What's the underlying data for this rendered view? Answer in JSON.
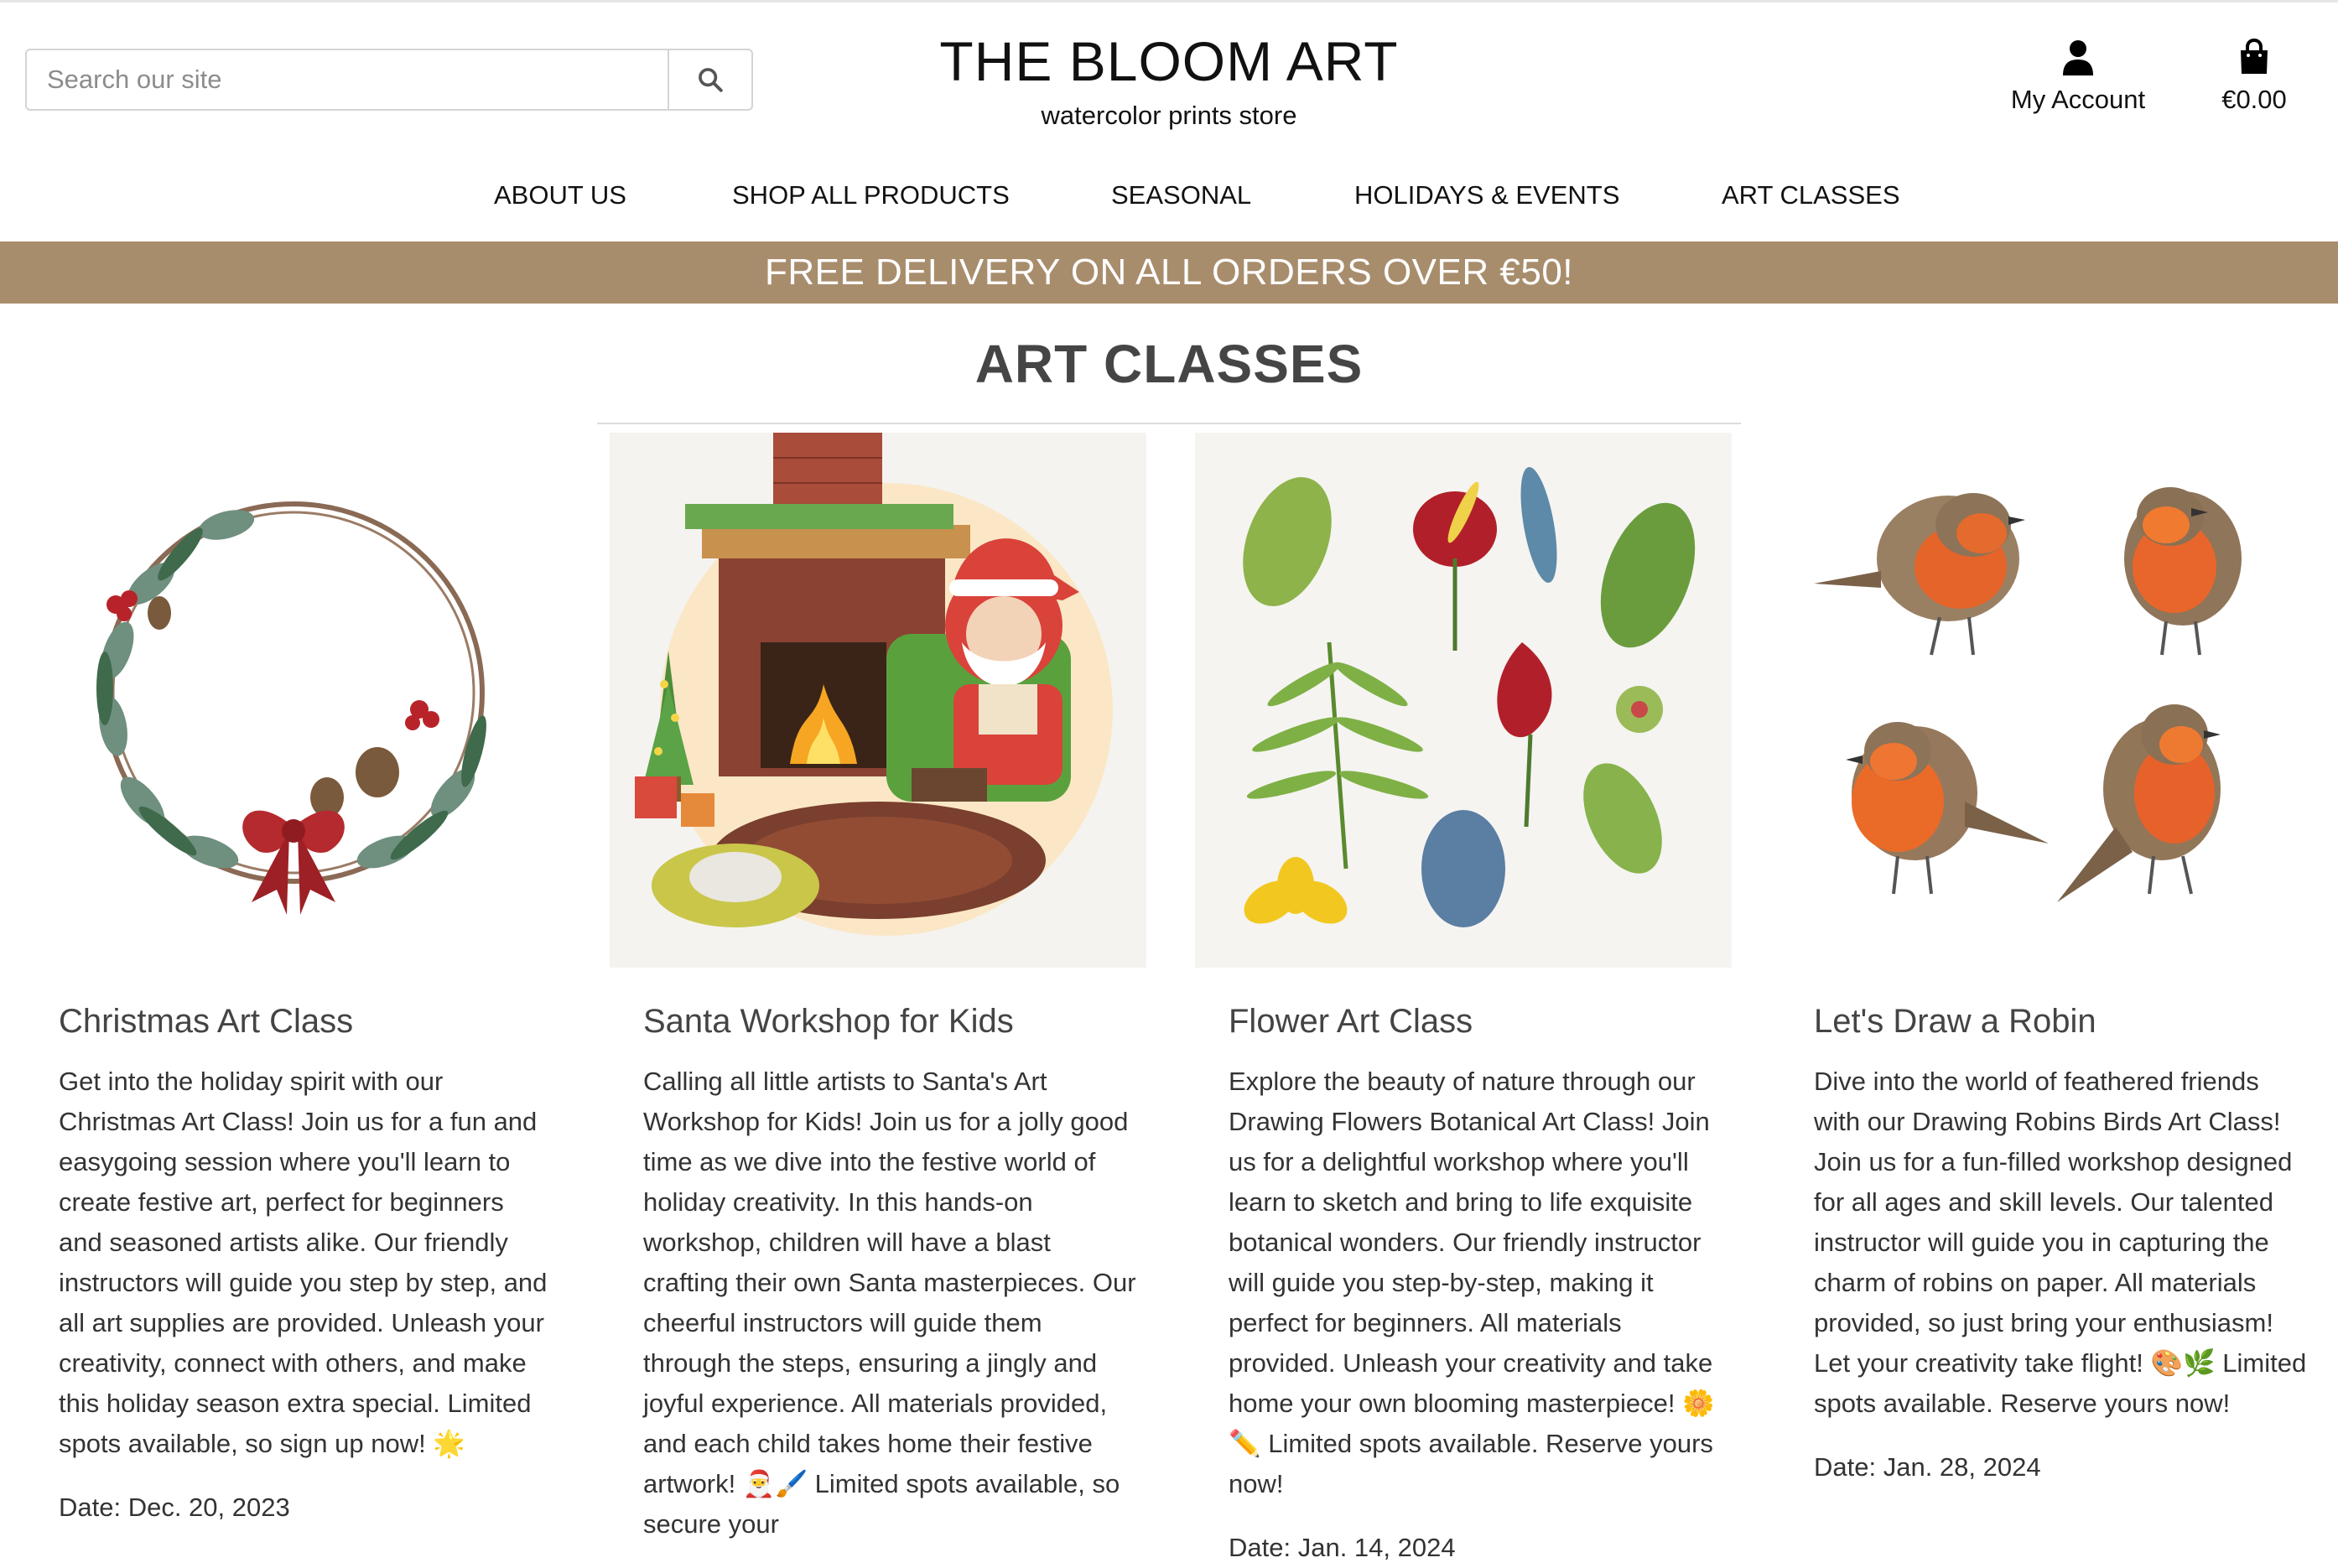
{
  "search": {
    "placeholder": "Search our site",
    "icon": "search-icon"
  },
  "brand": {
    "title": "THE BLOOM ART",
    "subtitle": "watercolor prints store"
  },
  "account": {
    "label": "My Account",
    "icon": "user-icon"
  },
  "cart": {
    "total": "€0.00",
    "icon": "shopping-bag-icon"
  },
  "nav": {
    "items": [
      {
        "label": "ABOUT US"
      },
      {
        "label": "SHOP ALL PRODUCTS"
      },
      {
        "label": "SEASONAL"
      },
      {
        "label": "HOLIDAYS & EVENTS"
      },
      {
        "label": "ART CLASSES"
      }
    ]
  },
  "banner": {
    "text": "FREE DELIVERY ON ALL ORDERS OVER €50!"
  },
  "page": {
    "title": "ART CLASSES"
  },
  "classes": [
    {
      "title": "Christmas Art Class",
      "description": "Get into the holiday spirit with our Christmas Art Class! Join us for a fun and easygoing session where you'll learn to create festive art, perfect for beginners and seasoned artists alike. Our friendly instructors will guide you step by step, and all art supplies are provided. Unleash your creativity, connect with others, and make this holiday season extra special. Limited spots available, so sign up now! 🌟",
      "date": "Date: Dec. 20, 2023",
      "image": "watercolor-christmas-wreath"
    },
    {
      "title": "Santa Workshop for Kids",
      "description": "Calling all little artists to Santa's Art Workshop for Kids! Join us for a jolly good time as we dive into the festive world of holiday creativity. In this hands-on workshop, children will have a blast crafting their own Santa masterpieces. Our cheerful instructors will guide them through the steps, ensuring a jingly and joyful experience. All materials provided, and each child takes home their festive artwork! 🎅🖌️ Limited spots available, so secure your",
      "date": "",
      "image": "watercolor-santa-by-fireplace"
    },
    {
      "title": "Flower Art Class",
      "description": "Explore the beauty of nature through our Drawing Flowers Botanical Art Class! Join us for a delightful workshop where you'll learn to sketch and bring to life exquisite botanical wonders. Our friendly instructor will guide you step-by-step, making it perfect for beginners. All materials provided. Unleash your creativity and take home your own blooming masterpiece! 🌼✏️ Limited spots available. Reserve yours now!",
      "date": "Date: Jan. 14, 2024",
      "image": "watercolor-botanical-flowers"
    },
    {
      "title": "Let's Draw a Robin",
      "description": "Dive into the world of feathered friends with our Drawing Robins Birds Art Class! Join us for a fun-filled workshop designed for all ages and skill levels. Our talented instructor will guide you in capturing the charm of robins on paper. All materials provided, so just bring your enthusiasm! Let your creativity take flight! 🎨🌿 Limited spots available. Reserve yours now!",
      "date": "Date: Jan. 28, 2024",
      "image": "watercolor-robins"
    }
  ]
}
